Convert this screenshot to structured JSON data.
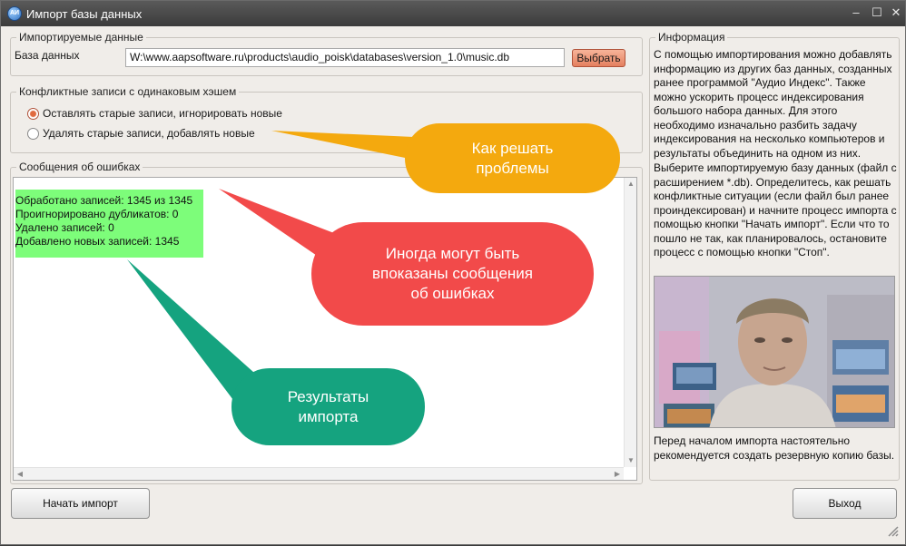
{
  "window": {
    "title": "Импорт базы данных",
    "icon_text": "АИ",
    "minimize_glyph": "–",
    "maximize_glyph": "☐",
    "close_glyph": "✕"
  },
  "imported_data": {
    "legend": "Импортируемые данные",
    "database_label": "База данных",
    "database_path": "W:\\www.aapsoftware.ru\\products\\audio_poisk\\databases\\version_1.0\\music.db",
    "browse_button": "Выбрать"
  },
  "conflicts": {
    "legend": "Конфликтные записи с одинаковым хэшем",
    "options": [
      {
        "label": "Оставлять старые записи, игнорировать новые",
        "checked": true
      },
      {
        "label": "Удалять старые записи, добавлять новые",
        "checked": false
      }
    ]
  },
  "errors": {
    "legend": "Сообщения об ошибках",
    "lines": [
      "Обработано записей: 1345 из 1345",
      "Проигнорировано дубликатов: 0",
      "Удалено записей: 0",
      "Добавлено новых записей: 1345"
    ],
    "highlight_color": "#7dfd7a"
  },
  "info": {
    "legend": "Информация",
    "paragraphs": [
      "С помощью импортирования можно добавлять информацию из других баз данных, созданных ранее программой \"Аудио Индекс\". Также можно ускорить процесс индексирования большого набора данных. Для этого необходимо изначально разбить задачу индексирования на несколько компьютеров и результаты объединить на одном из них.",
      "Выберите импортируемую базу данных (файл с расширением *.db). Определитесь, как решать конфликтные ситуации (если файл был ранее проиндексирован) и начните процесс импорта с помощью кнопки \"Начать импорт\". Если что то пошло не так, как планировалось, остановите процесс с помощью кнопки \"Стоп\".",
      "Перед началом импорта настоятельно рекомендуется создать резервную копию базы."
    ]
  },
  "buttons": {
    "start_import": "Начать импорт",
    "exit": "Выход"
  },
  "annotations": {
    "conflicts_hint": "Как решать проблемы",
    "errors_hint": "Иногда могут быть впоказаны сообщения об ошибках",
    "results_hint": "Результаты импорта",
    "colors": {
      "conflicts_hint": "#f4a90e",
      "errors_hint": "#f24a4a",
      "results_hint": "#15a37f"
    }
  }
}
